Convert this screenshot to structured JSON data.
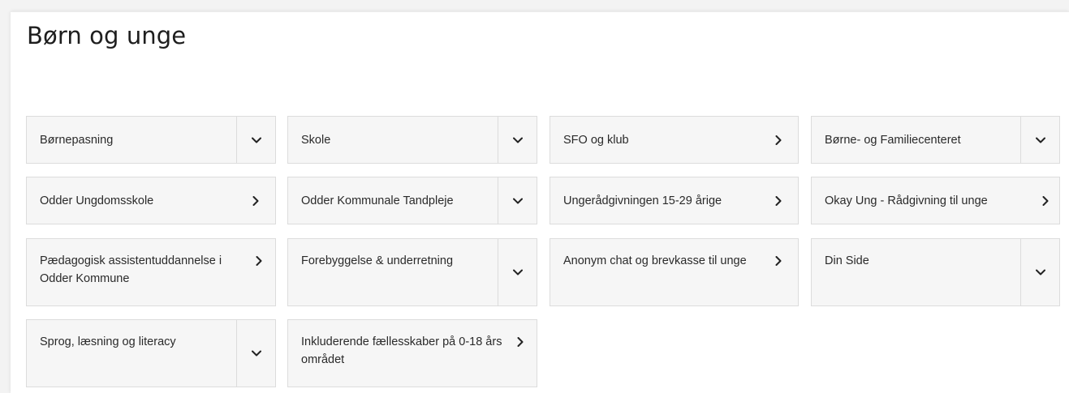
{
  "page": {
    "title": "Børn og unge"
  },
  "cards": [
    {
      "label": "Børnepasning",
      "icon": "chevron-down-icon"
    },
    {
      "label": "Skole",
      "icon": "chevron-down-icon"
    },
    {
      "label": "SFO og klub",
      "icon": "chevron-right-icon"
    },
    {
      "label": "Børne- og Familiecenteret",
      "icon": "chevron-down-icon"
    },
    {
      "label": "Odder Ungdomsskole",
      "icon": "chevron-right-icon"
    },
    {
      "label": "Odder Kommunale Tandpleje",
      "icon": "chevron-down-icon"
    },
    {
      "label": "Ungerådgivningen 15-29 årige",
      "icon": "chevron-right-icon"
    },
    {
      "label": "Okay Ung - Rådgivning til unge",
      "icon": "chevron-right-icon"
    },
    {
      "label": "Pædagogisk assistentuddannelse i Odder Kommune",
      "icon": "chevron-right-icon"
    },
    {
      "label": "Forebyggelse & underretning",
      "icon": "chevron-down-icon"
    },
    {
      "label": "Anonym chat og brevkasse til unge",
      "icon": "chevron-right-icon"
    },
    {
      "label": "Din Side",
      "icon": "chevron-down-icon"
    },
    {
      "label": "Sprog, læsning og literacy",
      "icon": "chevron-down-icon"
    },
    {
      "label": "Inkluderende fællesskaber på 0-18 års området",
      "icon": "chevron-right-icon"
    }
  ],
  "colors": {
    "card_background": "#f6f6f6",
    "card_border": "#dcdcdc",
    "text": "#2a2a2a",
    "icon": "#222222"
  }
}
